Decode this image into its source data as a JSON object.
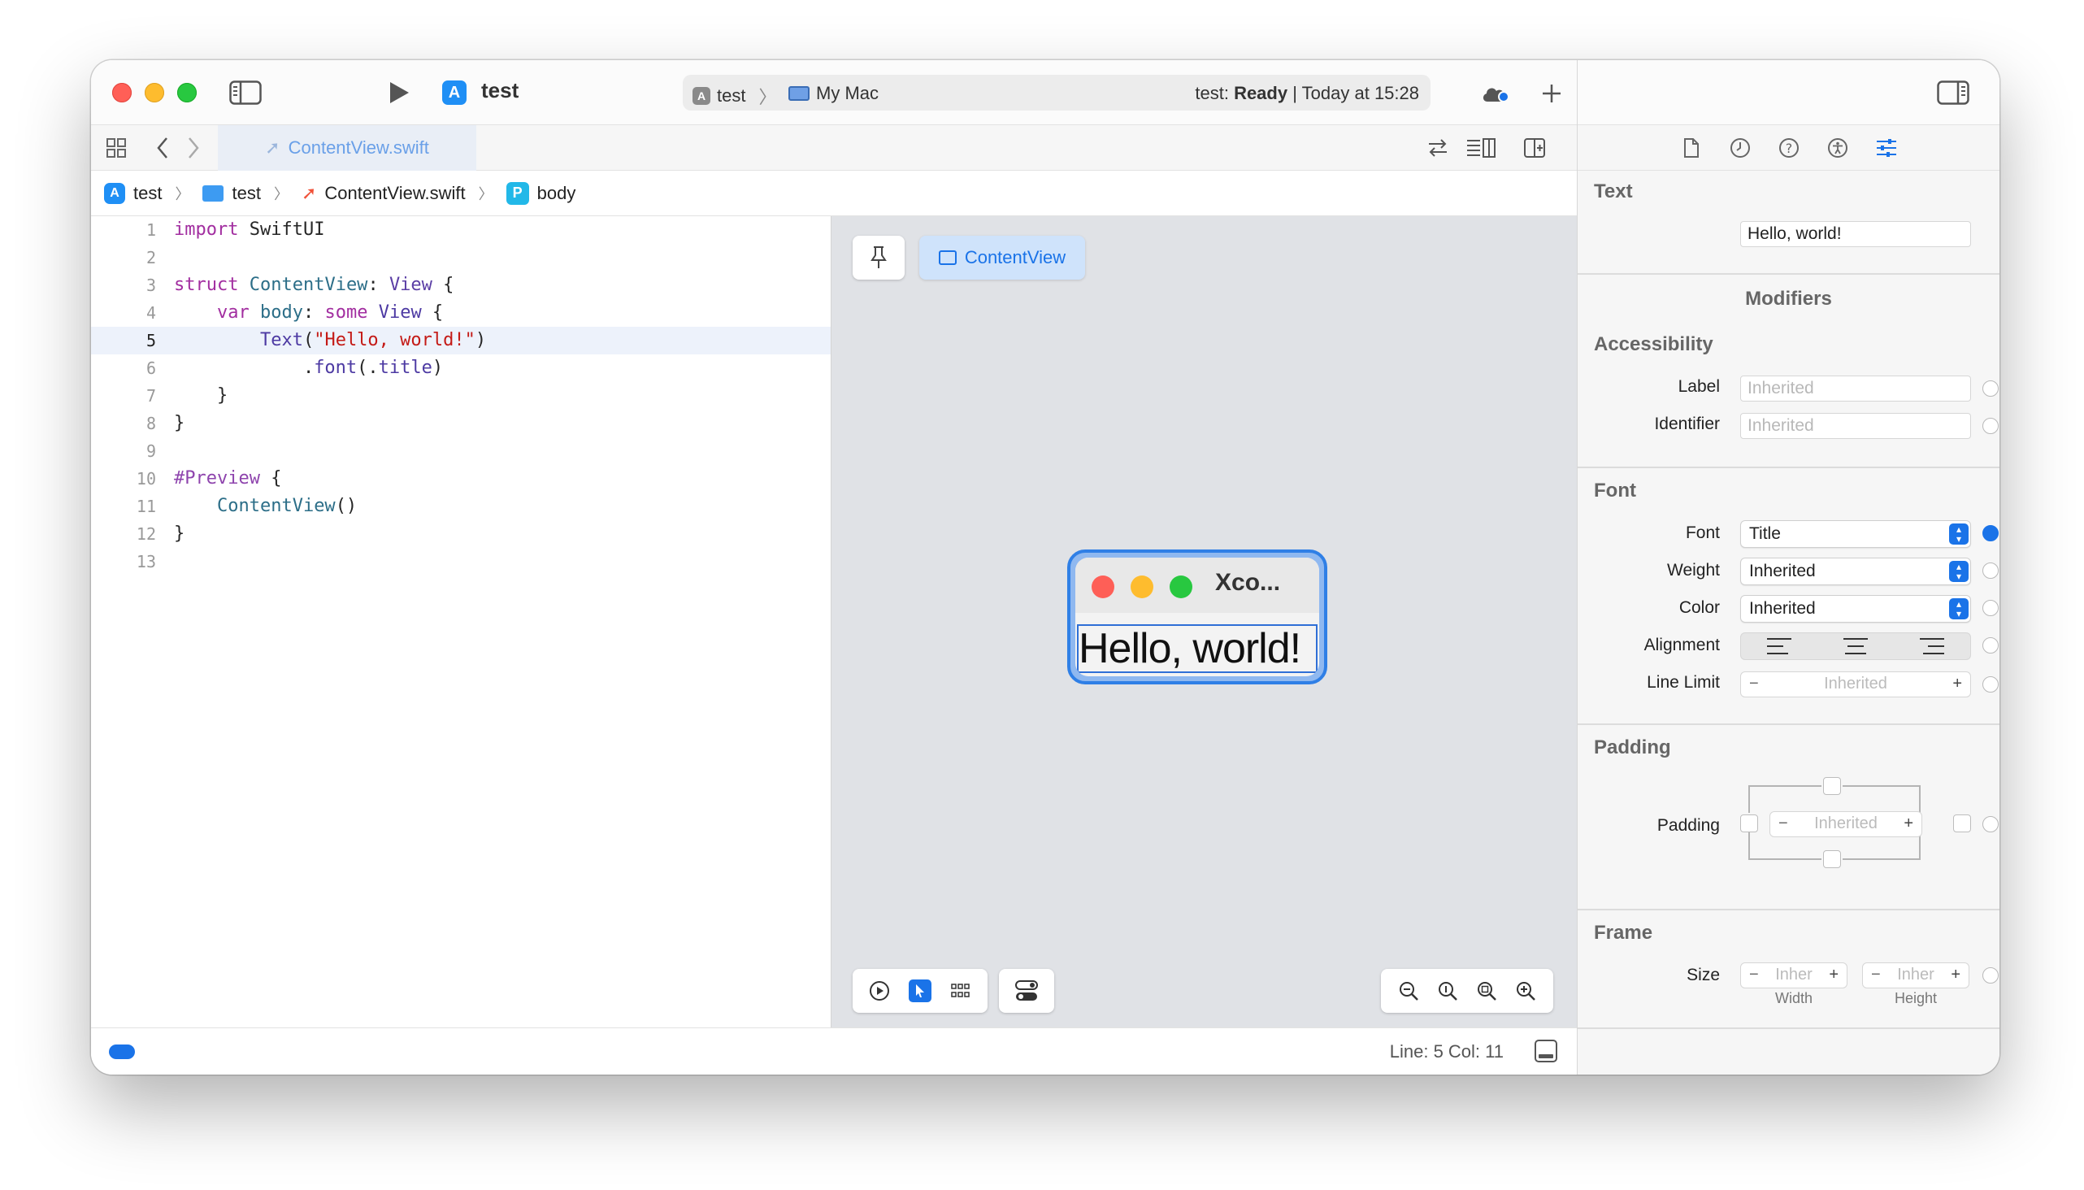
{
  "toolbar": {
    "scheme_name": "test",
    "activity": {
      "target": "test",
      "destination": "My Mac",
      "status_prefix": "test:",
      "status_state": "Ready",
      "status_suffix": "| Today at 15:28"
    },
    "icons": [
      "sidebar-toggle-icon",
      "run-icon",
      "app-target-icon",
      "cloud-toggle-icon",
      "plus-icon",
      "inspector-toggle-icon"
    ]
  },
  "tabs": {
    "active_tab": "ContentView.swift"
  },
  "breadcrumb": {
    "items": [
      "test",
      "test",
      "ContentView.swift",
      "body"
    ],
    "p_badge": "P"
  },
  "editor": {
    "active_line": 5,
    "line_numbers": [
      "1",
      "2",
      "3",
      "4",
      "5",
      "6",
      "7",
      "8",
      "9",
      "10",
      "11",
      "12",
      "13"
    ]
  },
  "preview": {
    "view_chip": "ContentView",
    "window_title": "Xco...",
    "text": "Hello, world!"
  },
  "statusbar": {
    "line_col": "Line: 5  Col: 11"
  },
  "inspector": {
    "text_section": {
      "title": "Text",
      "value": "Hello, world!"
    },
    "modifiers_title": "Modifiers",
    "accessibility": {
      "title": "Accessibility",
      "label_label": "Label",
      "label_placeholder": "Inherited",
      "identifier_label": "Identifier",
      "identifier_placeholder": "Inherited"
    },
    "font": {
      "title": "Font",
      "font_label": "Font",
      "font_value": "Title",
      "weight_label": "Weight",
      "weight_value": "Inherited",
      "color_label": "Color",
      "color_value": "Inherited",
      "alignment_label": "Alignment",
      "line_limit_label": "Line Limit",
      "line_limit_value": "Inherited"
    },
    "padding": {
      "title": "Padding",
      "row_label": "Padding",
      "value": "Inherited"
    },
    "frame": {
      "title": "Frame",
      "size_label": "Size",
      "width_value": "Inher",
      "height_value": "Inher",
      "width_caption": "Width",
      "height_caption": "Height"
    }
  },
  "colors": {
    "accent": "#1a73e8",
    "keyword": "#a22ea0",
    "type": "#2c6e88",
    "string": "#c41a16"
  }
}
